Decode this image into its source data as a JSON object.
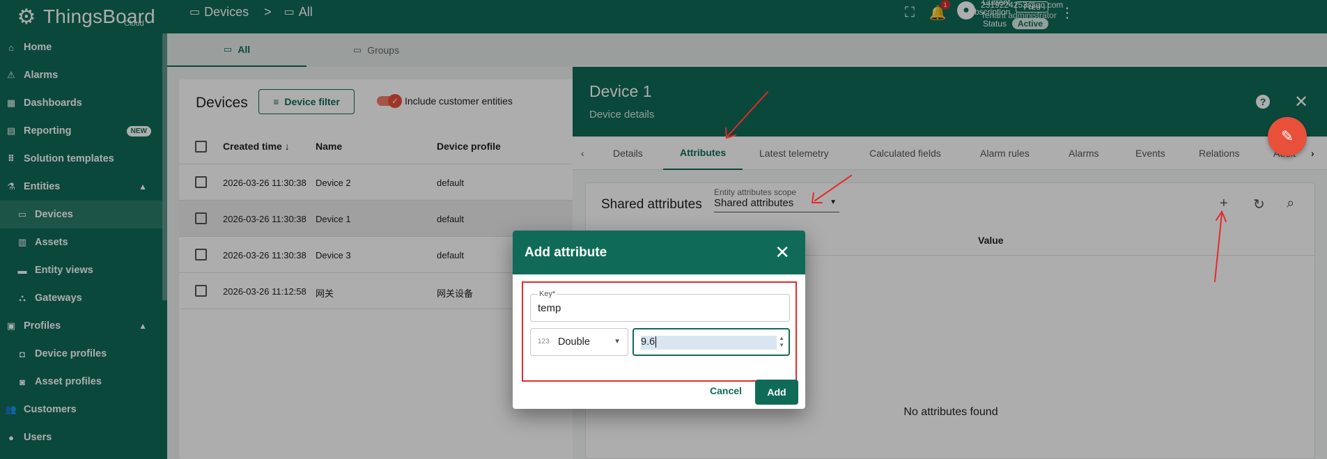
{
  "app": {
    "brand": "ThingsBoard",
    "brand_sub": "Cloud"
  },
  "sidebar": {
    "items": [
      {
        "label": "Home"
      },
      {
        "label": "Alarms"
      },
      {
        "label": "Dashboards"
      },
      {
        "label": "Reporting",
        "badge": "NEW"
      },
      {
        "label": "Solution templates"
      },
      {
        "label": "Entities"
      },
      {
        "label": "Devices"
      },
      {
        "label": "Assets"
      },
      {
        "label": "Entity views"
      },
      {
        "label": "Gateways"
      },
      {
        "label": "Profiles"
      },
      {
        "label": "Device profiles"
      },
      {
        "label": "Asset profiles"
      },
      {
        "label": "Customers"
      },
      {
        "label": "Users"
      }
    ]
  },
  "topbar": {
    "breadcrumb": [
      "Devices",
      ">",
      "All"
    ],
    "subscription_label": "Current subscription",
    "subscription_value": "Free",
    "status_label": "Status",
    "status_value": "Active",
    "notification_count": "1",
    "user_email": "2319224253@qq.com",
    "user_role": "Tenant administrator"
  },
  "tabs": {
    "all": "All",
    "groups": "Groups"
  },
  "devices": {
    "title": "Devices",
    "filter_button": "Device filter",
    "include_customer": "Include customer entities",
    "columns": [
      "Created time",
      "Name",
      "Device profile"
    ],
    "rows": [
      {
        "created": "2026-03-26 11:30:38",
        "name": "Device 2",
        "profile": "default"
      },
      {
        "created": "2026-03-26 11:30:38",
        "name": "Device 1",
        "profile": "default"
      },
      {
        "created": "2026-03-26 11:30:38",
        "name": "Device 3",
        "profile": "default"
      },
      {
        "created": "2026-03-26 11:12:58",
        "name": "网关",
        "profile": "网关设备"
      }
    ]
  },
  "details": {
    "title": "Device 1",
    "subtitle": "Device details",
    "tabs": [
      "Details",
      "Attributes",
      "Latest telemetry",
      "Calculated fields",
      "Alarm rules",
      "Alarms",
      "Events",
      "Relations",
      "Audit"
    ],
    "attr_title": "Shared attributes",
    "scope_label": "Entity attributes scope",
    "scope_value": "Shared attributes",
    "value_header": "Value",
    "empty": "No attributes found"
  },
  "dialog": {
    "title": "Add attribute",
    "key_label": "Key*",
    "key_value": "temp",
    "type_prefix": "123",
    "type_value": "Double",
    "value": "9.6",
    "cancel": "Cancel",
    "add": "Add"
  },
  "colors": {
    "primary": "#0f6b58",
    "accent": "#e8503a",
    "annotation": "#e32b2b"
  }
}
